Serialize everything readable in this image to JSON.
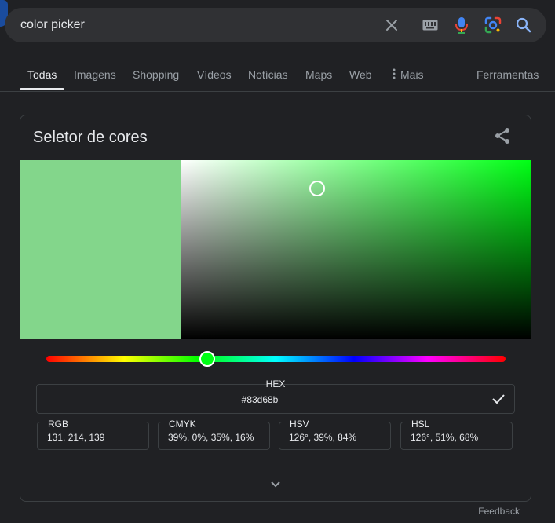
{
  "search": {
    "query": "color picker"
  },
  "tabs": [
    {
      "label": "Todas",
      "active": true
    },
    {
      "label": "Imagens"
    },
    {
      "label": "Shopping"
    },
    {
      "label": "Vídeos"
    },
    {
      "label": "Notícias"
    },
    {
      "label": "Maps"
    },
    {
      "label": "Web"
    },
    {
      "label": "Mais",
      "icon": "more-vert-icon"
    }
  ],
  "tools_label": "Ferramentas",
  "picker": {
    "title": "Seletor de cores",
    "color": "#83d68b",
    "hue_color": "#00ff15",
    "hue": 126,
    "saturation": 0.39,
    "value": 0.84,
    "hex_label": "HEX",
    "hex_value": "#83d68b",
    "formats": [
      {
        "label": "RGB",
        "value": "131, 214, 139"
      },
      {
        "label": "CMYK",
        "value": "39%, 0%, 35%, 16%"
      },
      {
        "label": "HSV",
        "value": "126°, 39%, 84%"
      },
      {
        "label": "HSL",
        "value": "126°, 51%, 68%"
      }
    ]
  },
  "feedback_label": "Feedback"
}
